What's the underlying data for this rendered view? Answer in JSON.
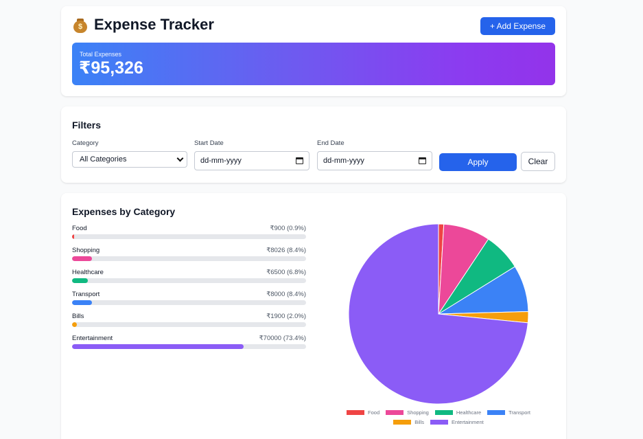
{
  "header": {
    "icon": "money-bag-icon",
    "title": "Expense Tracker",
    "add_button": "+ Add Expense",
    "total_label": "Total Expenses",
    "total_value": "₹95,326"
  },
  "filters": {
    "title": "Filters",
    "category_label": "Category",
    "category_selected": "All Categories",
    "start_label": "Start Date",
    "start_value": "dd-mm-yyyy",
    "end_label": "End Date",
    "end_value": "dd-mm-yyyy",
    "apply_label": "Apply",
    "clear_label": "Clear"
  },
  "categories_section": {
    "title": "Expenses by Category",
    "items": [
      {
        "name": "Food",
        "amount": "₹900 (0.9%)"
      },
      {
        "name": "Shopping",
        "amount": "₹8026 (8.4%)"
      },
      {
        "name": "Healthcare",
        "amount": "₹6500 (6.8%)"
      },
      {
        "name": "Transport",
        "amount": "₹8000 (8.4%)"
      },
      {
        "name": "Bills",
        "amount": "₹1900 (2.0%)"
      },
      {
        "name": "Entertainment",
        "amount": "₹70000 (73.4%)"
      }
    ]
  },
  "chart_data": {
    "type": "pie",
    "categories": [
      "Food",
      "Shopping",
      "Healthcare",
      "Transport",
      "Bills",
      "Entertainment"
    ],
    "values": [
      900,
      8026,
      6500,
      8000,
      1900,
      70000
    ],
    "colors": [
      "#ef4444",
      "#ec4899",
      "#10b981",
      "#3b82f6",
      "#f59e0b",
      "#8b5cf6"
    ],
    "legend_position": "bottom"
  }
}
